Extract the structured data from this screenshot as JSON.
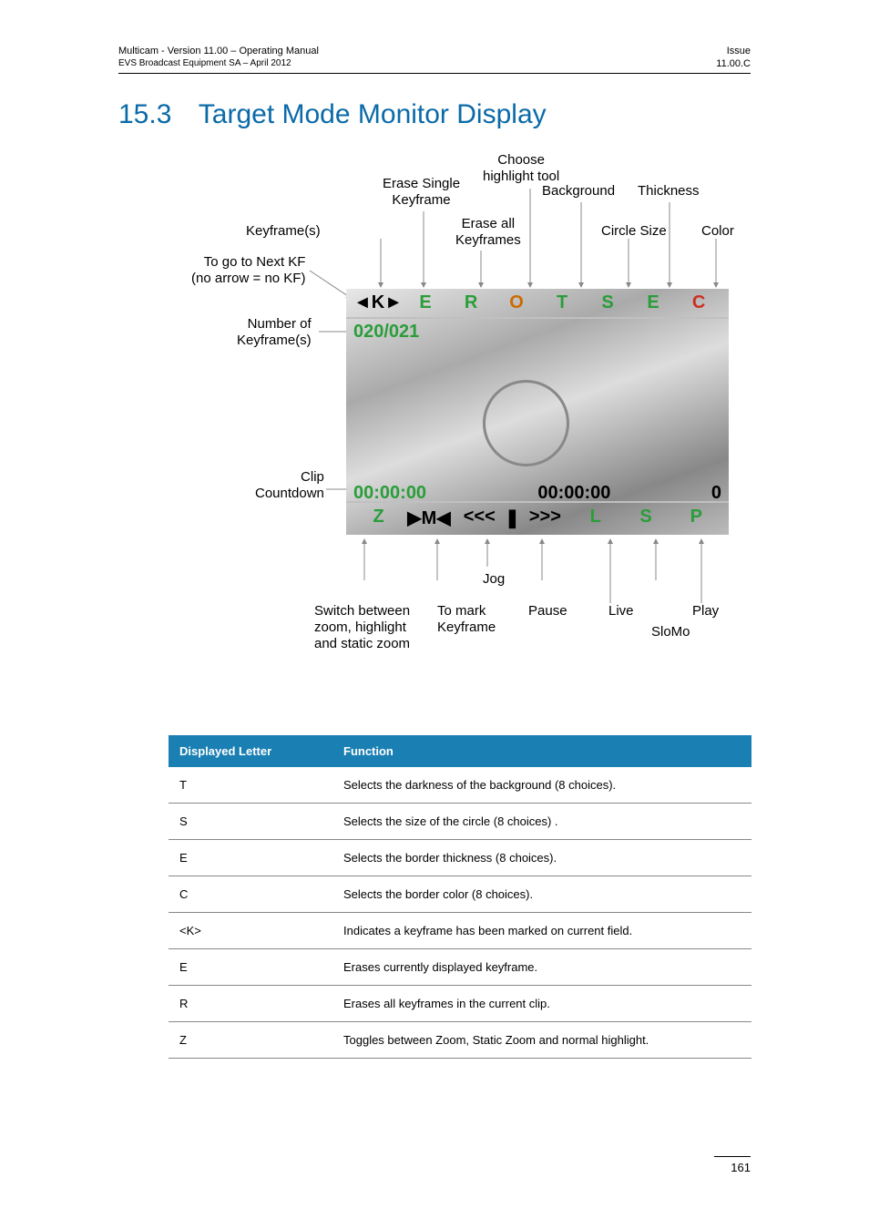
{
  "header": {
    "left_top": "Multicam - Version 11.00 – Operating Manual",
    "left_bottom": "EVS Broadcast Equipment SA – April 2012",
    "right_top": "Issue",
    "right_bottom": "11.00.C"
  },
  "section": {
    "number": "15.3",
    "title": "Target Mode Monitor Display"
  },
  "diagram": {
    "top_labels": {
      "choose_highlight": "Choose\nhighlight tool",
      "erase_single_kf": "Erase Single\nKeyframe",
      "background": "Background",
      "thickness": "Thickness",
      "erase_all_kf": "Erase all\nKeyframes",
      "circle_size": "Circle Size",
      "color": "Color",
      "keyframes": "Keyframe(s)",
      "goto_next_kf": "To go to Next KF\n(no arrow = no KF)",
      "num_keyframes": "Number of\nKeyframe(s)",
      "clip_countdown": "Clip\nCountdown"
    },
    "osd_top": {
      "k": "◄K►",
      "e1": "E",
      "r": "R",
      "o": "O",
      "t": "T",
      "s": "S",
      "e2": "E",
      "c": "C"
    },
    "kf_count": "020/021",
    "osd_mid": {
      "tc1": "00:00:00",
      "tc2": "00:00:00",
      "zero": "0"
    },
    "osd_bot": {
      "z": "Z",
      "m": "▶M◀",
      "rew": "<<<",
      "pause": "❚",
      "fwd": ">>>",
      "l": "L",
      "s": "S",
      "p": "P"
    },
    "bottom_labels": {
      "jog": "Jog",
      "switch": "Switch between\nzoom, highlight\nand static zoom",
      "mark_kf": "To mark\nKeyframe",
      "pause": "Pause",
      "live": "Live",
      "play": "Play",
      "slomo": "SloMo"
    }
  },
  "table": {
    "headers": {
      "letter": "Displayed Letter",
      "function": "Function"
    },
    "rows": [
      {
        "letter": "T",
        "function": "Selects the darkness of the background (8 choices)."
      },
      {
        "letter": "S",
        "function": "Selects the size of the circle (8 choices) ."
      },
      {
        "letter": "E",
        "function": "Selects the border thickness (8 choices)."
      },
      {
        "letter": "C",
        "function": "Selects the border color (8 choices)."
      },
      {
        "letter": "<K>",
        "function": "Indicates a keyframe has been marked on current field."
      },
      {
        "letter": "E",
        "function": "Erases currently displayed keyframe."
      },
      {
        "letter": "R",
        "function": "Erases all keyframes in the current clip."
      },
      {
        "letter": "Z",
        "function": "Toggles between Zoom, Static Zoom and normal highlight."
      }
    ]
  },
  "page_number": "161"
}
